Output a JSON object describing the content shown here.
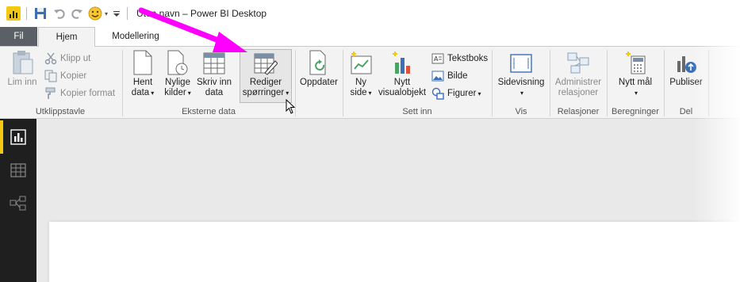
{
  "window": {
    "title": "Uten navn – Power BI Desktop"
  },
  "tabs": [
    {
      "label": "Fil"
    },
    {
      "label": "Hjem"
    },
    {
      "label": "Modellering"
    }
  ],
  "ribbon": {
    "utklippstavle": {
      "label": "Utklippstavle",
      "lim_inn": "Lim inn",
      "klipp_ut": "Klipp ut",
      "kopier": "Kopier",
      "kopier_format": "Kopier format"
    },
    "eksterne_data": {
      "label": "Eksterne data",
      "hent_data": [
        "Hent",
        "data"
      ],
      "nylige_kilder": [
        "Nylige",
        "kilder"
      ],
      "skriv_inn_data": [
        "Skriv inn",
        "data"
      ],
      "rediger_sporringer": [
        "Rediger",
        "spørringer"
      ],
      "oppdater": "Oppdater"
    },
    "sett_inn": {
      "label": "Sett inn",
      "ny_side": [
        "Ny",
        "side"
      ],
      "nytt_visualobjekt": [
        "Nytt",
        "visualobjekt"
      ],
      "tekstboks": "Tekstboks",
      "bilde": "Bilde",
      "figurer": "Figurer"
    },
    "vis": {
      "label": "Vis",
      "sidevisning": "Sidevisning"
    },
    "relasjoner": {
      "label": "Relasjoner",
      "administrer_relasjoner": [
        "Administrer",
        "relasjoner"
      ]
    },
    "beregninger": {
      "label": "Beregninger",
      "nytt_mal": "Nytt mål"
    },
    "del": {
      "label": "Del",
      "publiser": "Publiser"
    }
  },
  "icons": {
    "app": "power-bi-logo-icon",
    "save": "save-icon",
    "undo": "undo-icon",
    "redo": "redo-icon",
    "smiley": "smiley-feedback-icon",
    "customize": "customize-quick-access-icon"
  },
  "colors": {
    "accent": "#f2c811",
    "annotation_arrow": "#ff00ff",
    "file_tab": "#5a6066",
    "left_nav": "#1f1f1f"
  }
}
